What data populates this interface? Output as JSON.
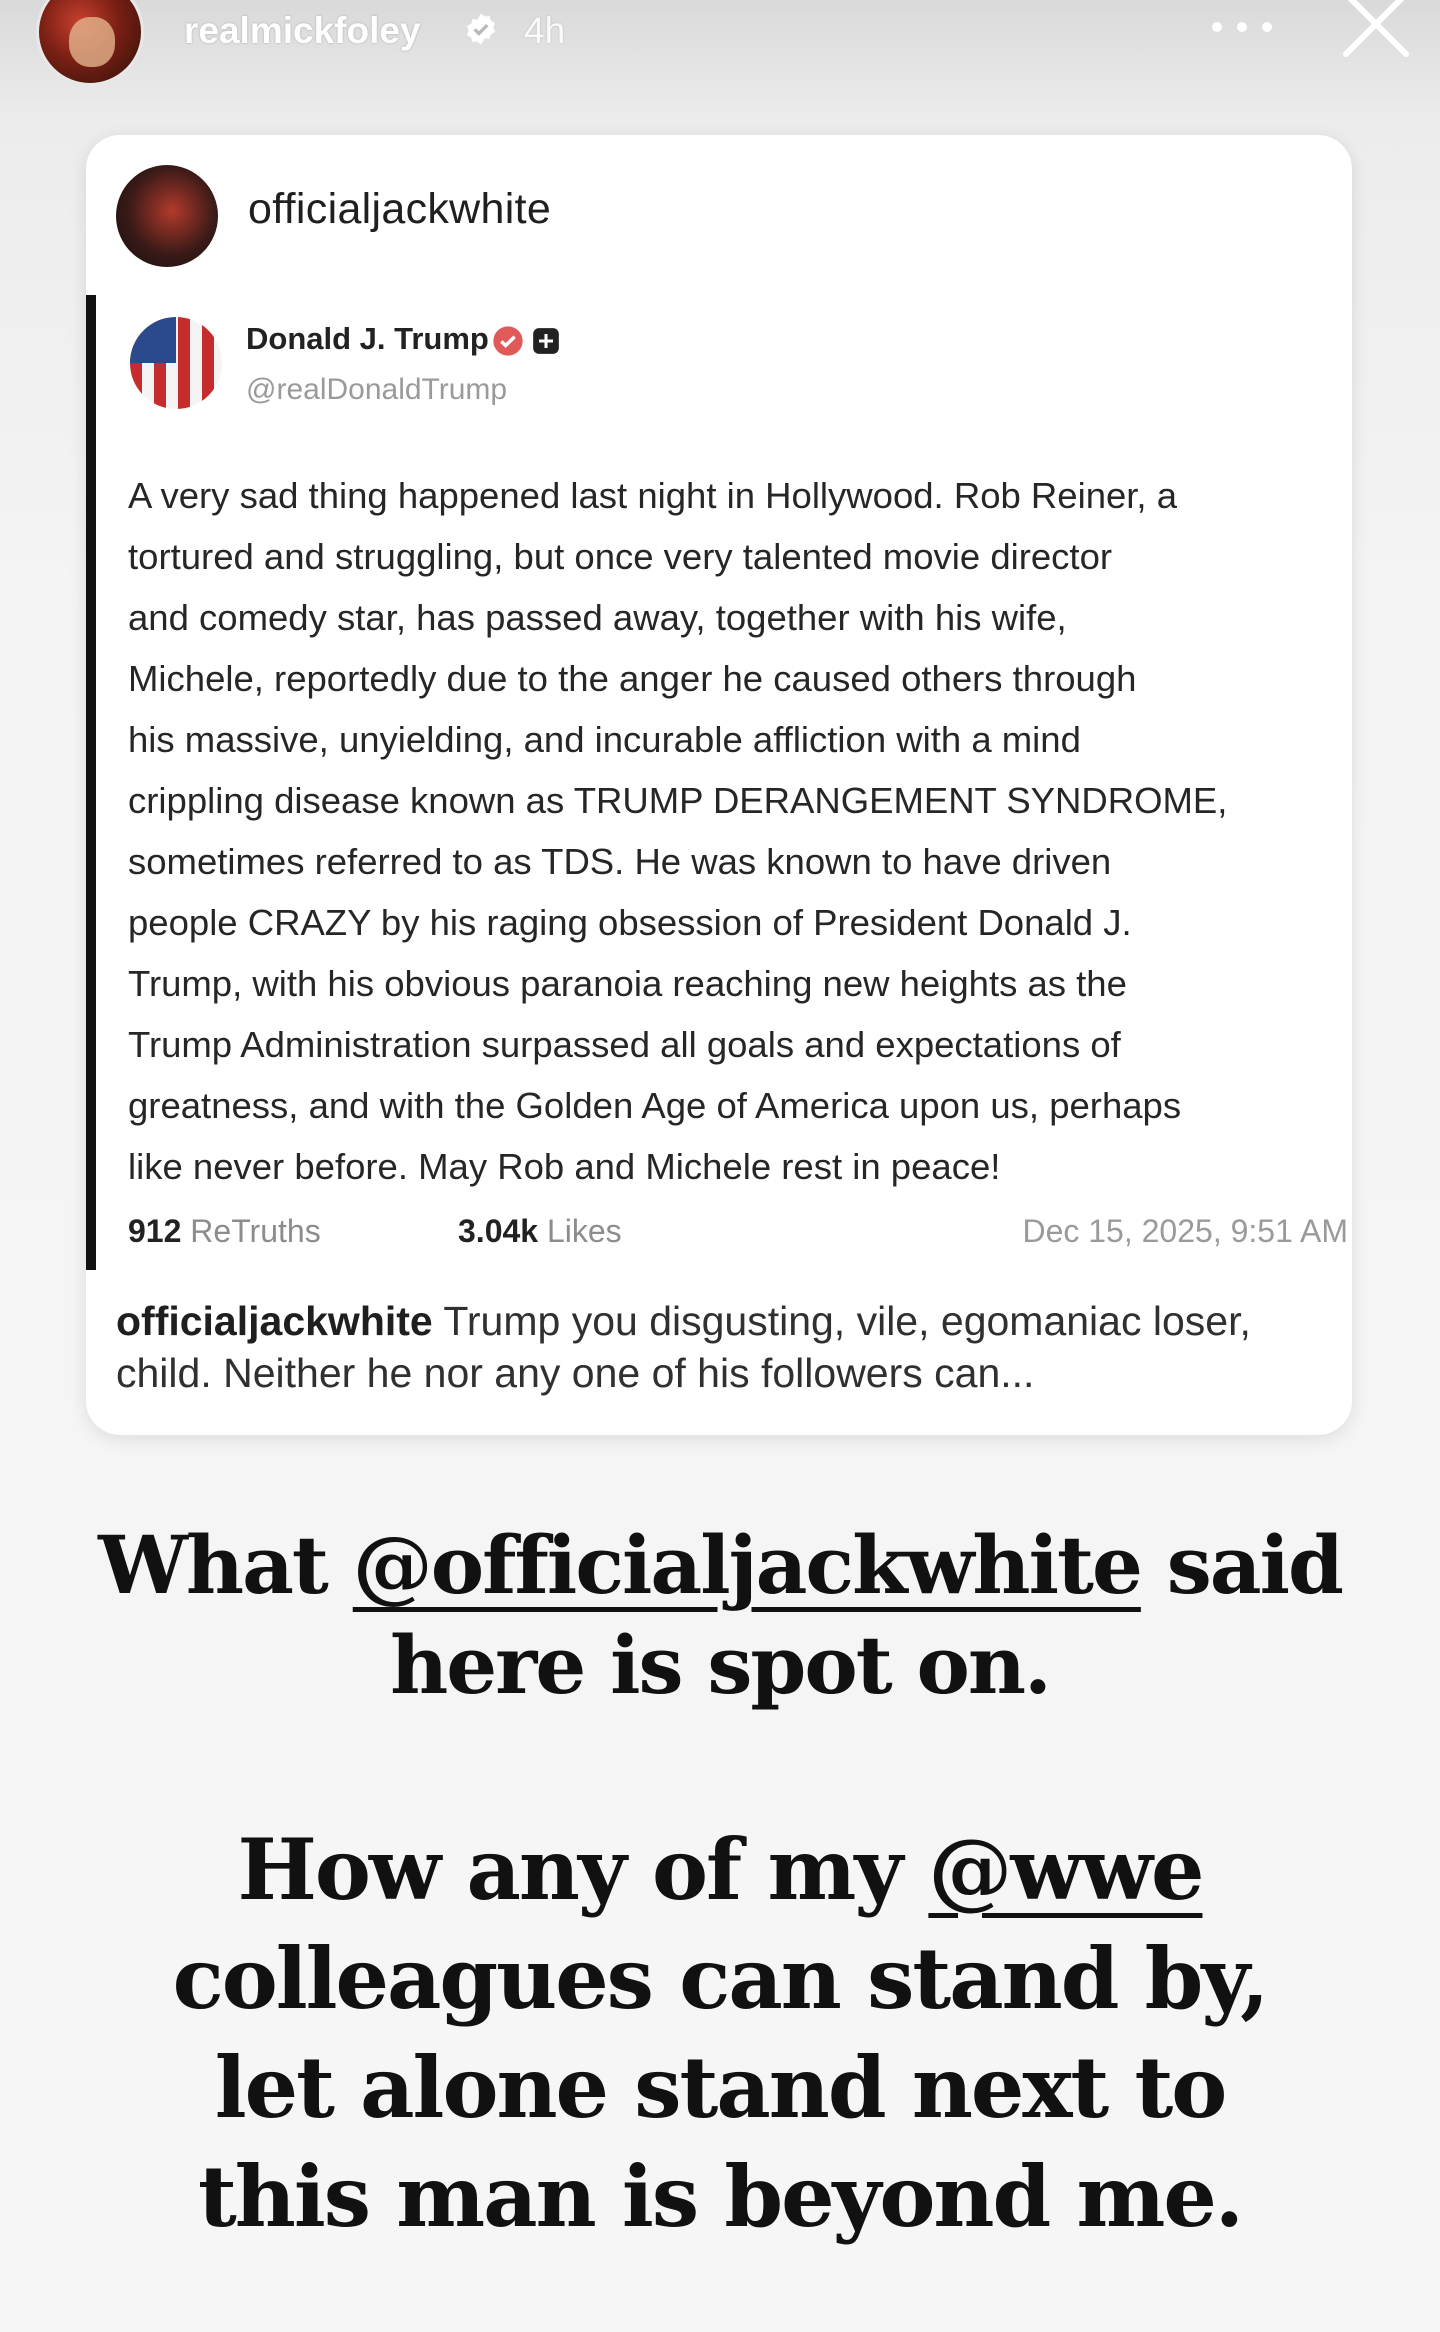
{
  "story": {
    "username": "realmickfoley",
    "time": "4h"
  },
  "quoted_post": {
    "username": "officialjackwhite",
    "embedded": {
      "name": "Donald J. Trump",
      "handle": "@realDonaldTrump",
      "body": [
        "A very sad thing happened last night in Hollywood. Rob Reiner, a",
        "tortured and struggling, but once very talented movie director",
        "and comedy star, has passed away, together with his wife,",
        "Michele, reportedly due to the anger he caused others through",
        "his massive, unyielding, and incurable affliction with a mind",
        "crippling disease known as TRUMP DERANGEMENT SYNDROME,",
        "sometimes referred to as TDS. He was known to have driven",
        "people CRAZY by his raging obsession of President Donald J.",
        "Trump, with his obvious paranoia reaching new heights as the",
        "Trump Administration surpassed all goals and expectations of",
        "greatness, and with the Golden Age of America upon us, perhaps",
        "like never before. May Rob and Michele rest in peace!"
      ],
      "retruths_count": "912",
      "retruths_label": "ReTruths",
      "likes_count": "3.04k",
      "likes_label": "Likes",
      "date": "Dec 15, 2025, 9:51 AM"
    },
    "caption_user": "officialjackwhite",
    "caption_text": " Trump you disgusting, vile, egomaniac loser, child. Neither he nor any one of his followers can..."
  },
  "overlay": {
    "line1_pre": "What ",
    "line1_mention": "@officialjackwhite",
    "line1_post": " said",
    "line2": "here is spot on.",
    "line3_pre": "How any of my ",
    "line3_mention": "@wwe",
    "line4": "colleagues can stand by,",
    "line5": "let alone stand next to",
    "line6": "this man is beyond me."
  },
  "colors": {
    "verified": "#3897f0",
    "truth_badge": "#e05a5a",
    "text": "#111111"
  },
  "icons": [
    "verified-icon",
    "more-icon",
    "close-icon",
    "truth-verified-icon",
    "truth-plus-icon"
  ]
}
